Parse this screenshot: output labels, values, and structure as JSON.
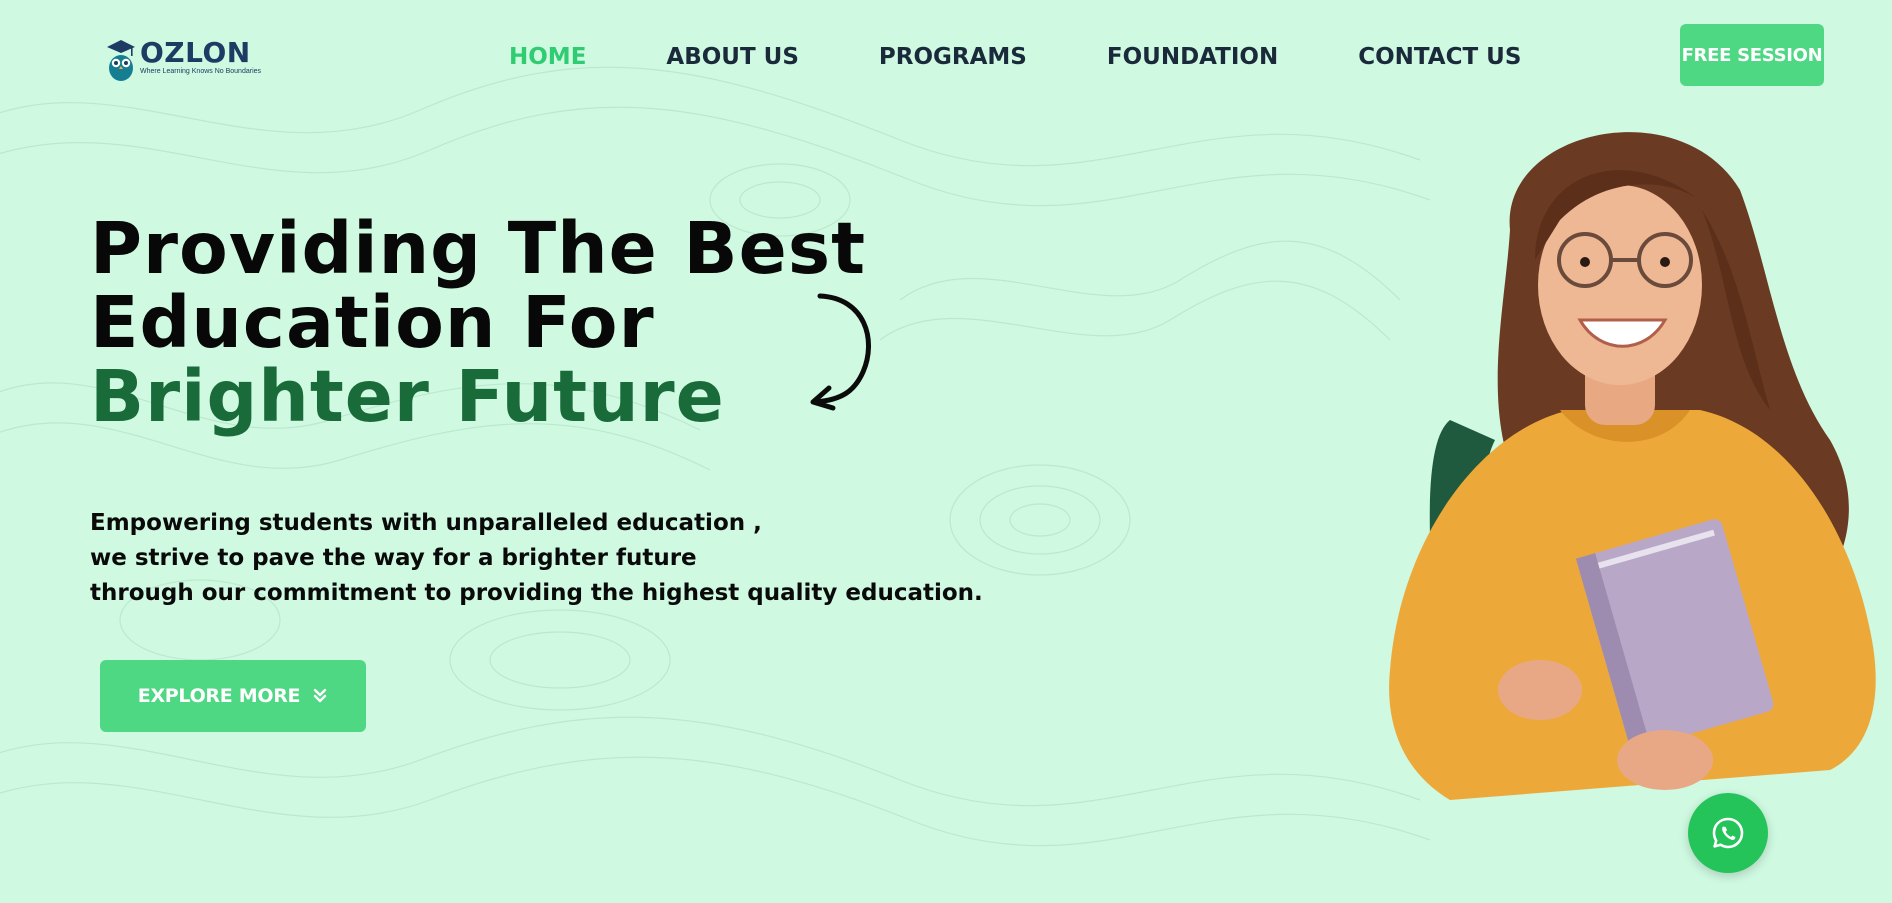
{
  "brand": {
    "name": "OZLON",
    "tagline": "Where Learning Knows No Boundaries",
    "icon": "owl-graduate-icon"
  },
  "nav": {
    "items": [
      {
        "label": "HOME",
        "active": true
      },
      {
        "label": "ABOUT US",
        "active": false
      },
      {
        "label": "PROGRAMS",
        "active": false
      },
      {
        "label": "FOUNDATION",
        "active": false
      },
      {
        "label": "CONTACT US",
        "active": false
      }
    ],
    "cta_label": "FREE SESSION"
  },
  "hero": {
    "title_line1": "Providing The Best",
    "title_line2": "Education For",
    "title_accent": "Brighter Future",
    "desc_line1": "Empowering students with unparalleled education ,",
    "desc_line2": "we strive to pave the way for a brighter future",
    "desc_line3": "through our commitment to providing the highest quality education.",
    "button_label": "EXPLORE MORE",
    "button_icon": "double-chevron-down-icon"
  },
  "floating": {
    "whatsapp_icon": "whatsapp-icon"
  },
  "colors": {
    "background": "#cff9e1",
    "accent_green": "#4ed883",
    "active_nav": "#2fcc72",
    "heading_accent": "#1a6b3a",
    "brand_navy": "#1d3b63",
    "whatsapp": "#25c45a"
  }
}
